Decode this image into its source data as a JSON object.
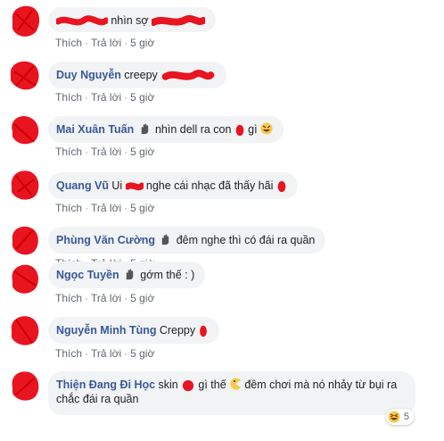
{
  "comments": [
    {
      "author": "",
      "text": "nhìn sợ",
      "time": "5 giờ"
    },
    {
      "author": "Duy Nguyễn",
      "text": "creepy",
      "time": "5 giờ"
    },
    {
      "author": "Mai Xuân Tuấn",
      "text_a": "nhìn dell ra con",
      "text_b": "gì",
      "time": "5 giờ"
    },
    {
      "author": "Quang Vũ",
      "text_a": "Ui",
      "text_b": "nghe cái nhạc đã thấy hãi",
      "time": "5 giờ"
    },
    {
      "author": "Phùng Văn Cường",
      "text": "đêm nghe thì có đái ra quần",
      "time": "5 giờ"
    },
    {
      "author": "Ngọc Tuyền",
      "text": "gớm thế : )",
      "time": "5 giờ"
    },
    {
      "author": "Nguyễn Minh Tùng",
      "text": "Creppy",
      "time": "5 giờ"
    },
    {
      "author": "Thiện Đang Đi Học",
      "text_a": "skin",
      "text_b": "gì thế",
      "text_c": "đêm chơi mà nó nhảy từ bụi ra chắc đái ra quần",
      "time": "",
      "reaction_count": "5"
    }
  ],
  "actions": {
    "like": "Thích",
    "reply": "Trả lời",
    "separator": "·"
  },
  "icons": {
    "wave": "waving-hand-icon",
    "laugh": "laughing-emoji-icon",
    "pacman": "pacman-emoji-icon",
    "haha": "haha-reaction-icon"
  },
  "colors": {
    "author": "#385898",
    "bubble": "#f2f3f5",
    "meta": "#606770",
    "redaction": "#e8141f"
  }
}
